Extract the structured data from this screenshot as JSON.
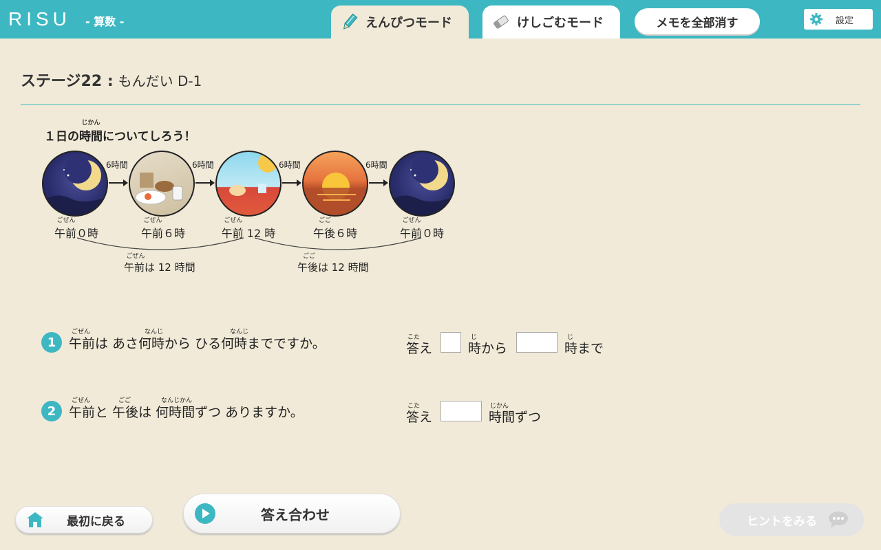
{
  "header": {
    "logo": "RISU",
    "subject": "- 算数 -",
    "tab_pencil": "えんぴつモード",
    "tab_eraser": "けしごむモード",
    "clear_memo": "メモを全部消す",
    "settings": "設定"
  },
  "stage": {
    "title": "ステージ22 :",
    "problem": "もんだい D-1"
  },
  "intro": {
    "title_prefix": "１日の",
    "title_kanji": "時間",
    "title_kanji_ruby": "じかん",
    "title_suffix": "についてしろう！",
    "steps": [
      "6時間",
      "6時間",
      "6時間",
      "6時間"
    ],
    "times": [
      {
        "label": "午前０時",
        "ruby": "ごぜん"
      },
      {
        "label": "午前６時",
        "ruby": "ごぜん"
      },
      {
        "label": "午前 12 時",
        "ruby": "ごぜん"
      },
      {
        "label": "午後６時",
        "ruby": "ごご"
      },
      {
        "label": "午前０時",
        "ruby": "ごぜん"
      }
    ],
    "spans": [
      {
        "label": "午前は 12 時間",
        "ruby": "ごぜん"
      },
      {
        "label": "午後は 12 時間",
        "ruby": "ごご"
      }
    ]
  },
  "questions": [
    {
      "number": "1",
      "text": "午前は あさ何時から ひる何時までですか。",
      "ruby_gozen": "ごぜん",
      "ruby_nanji": "なんじ",
      "answer_prefix": "答え",
      "answer_prefix_ruby": "こた",
      "middle": "時から",
      "middle_ruby": "じ",
      "suffix": "時まで",
      "suffix_ruby": "じ"
    },
    {
      "number": "2",
      "text": "午前と 午後は 何時間ずつ ありますか。",
      "ruby_gozen": "ごぜん",
      "ruby_gogo": "ごご",
      "ruby_nanjikan": "なんじかん",
      "answer_prefix": "答え",
      "answer_prefix_ruby": "こた",
      "suffix": "時間ずつ",
      "suffix_ruby": "じかん"
    }
  ],
  "footer": {
    "back": "最初に戻る",
    "check": "答え合わせ",
    "hint": "ヒントをみる"
  },
  "colors": {
    "accent": "#3db8c2",
    "background": "#f1ead8"
  }
}
